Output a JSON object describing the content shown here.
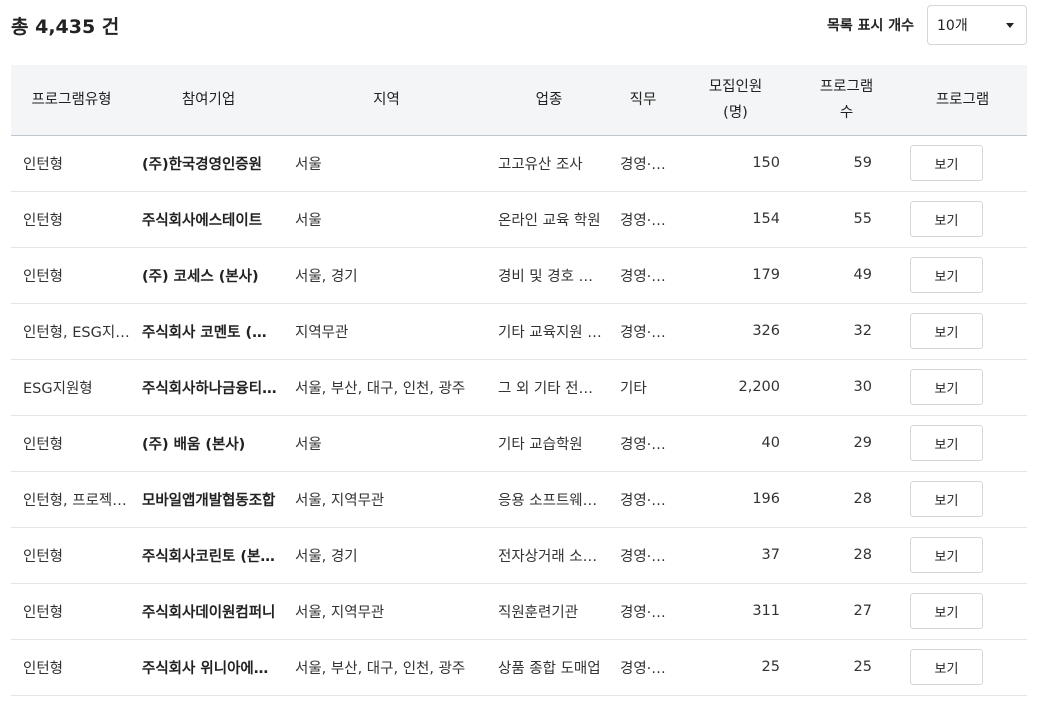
{
  "summary": {
    "total_text": "총 4,435 건"
  },
  "list_controls": {
    "per_page_label": "목록 표시 개수",
    "per_page_value": "10개"
  },
  "table": {
    "headers": {
      "type": "프로그램유형",
      "company": "참여기업",
      "region": "지역",
      "industry": "업종",
      "job": "직무",
      "recruit_line1": "모집인원",
      "recruit_line2": "(명)",
      "count_line1": "프로그램",
      "count_line2": "수",
      "program": "프로그램"
    },
    "view_label": "보기",
    "rows": [
      {
        "type": "인턴형",
        "company": "(주)한국경영인증원",
        "region": "서울",
        "industry": "고고유산 조사",
        "job": "경영·사무",
        "recruit": "150",
        "count": "59"
      },
      {
        "type": "인턴형",
        "company": "주식회사에스테이트",
        "region": "서울",
        "industry": "온라인 교육 학원",
        "job": "경영·사무",
        "recruit": "154",
        "count": "55"
      },
      {
        "type": "인턴형",
        "company": "(주) 코세스 (본사)",
        "region": "서울, 경기",
        "industry": "경비 및 경호 서비스업",
        "job": "경영·사무",
        "recruit": "179",
        "count": "49"
      },
      {
        "type": "인턴형, ESG지원형",
        "company": "주식회사 코멘토 (본사)",
        "region": "지역무관",
        "industry": "기타 교육지원 서비스업",
        "job": "경영·사무",
        "recruit": "326",
        "count": "32"
      },
      {
        "type": "ESG지원형",
        "company": "주식회사하나금융티아이",
        "region": "서울, 부산, 대구, 인천, 광주",
        "industry": "그 외 기타 전문 서비스업",
        "job": "기타",
        "recruit": "2,200",
        "count": "30"
      },
      {
        "type": "인턴형",
        "company": "(주)  배움 (본사)",
        "region": "서울",
        "industry": "기타 교습학원",
        "job": "경영·사무",
        "recruit": "40",
        "count": "29"
      },
      {
        "type": "인턴형, 프로젝트형",
        "company": "모바일앱개발협동조합",
        "region": "서울, 지역무관",
        "industry": "응용 소프트웨어 개발",
        "job": "경영·사무",
        "recruit": "196",
        "count": "28"
      },
      {
        "type": "인턴형",
        "company": "주식회사코린토 (본사)",
        "region": "서울, 경기",
        "industry": "전자상거래 소매업",
        "job": "경영·사무",
        "recruit": "37",
        "count": "28"
      },
      {
        "type": "인턴형",
        "company": "주식회사데이원컴퍼니",
        "region": "서울, 지역무관",
        "industry": "직원훈련기관",
        "job": "경영·사무",
        "recruit": "311",
        "count": "27"
      },
      {
        "type": "인턴형",
        "company": "주식회사 위니아에이드",
        "region": "서울, 부산, 대구, 인천, 광주",
        "industry": "상품 종합 도매업",
        "job": "경영·사무",
        "recruit": "25",
        "count": "25"
      }
    ]
  }
}
